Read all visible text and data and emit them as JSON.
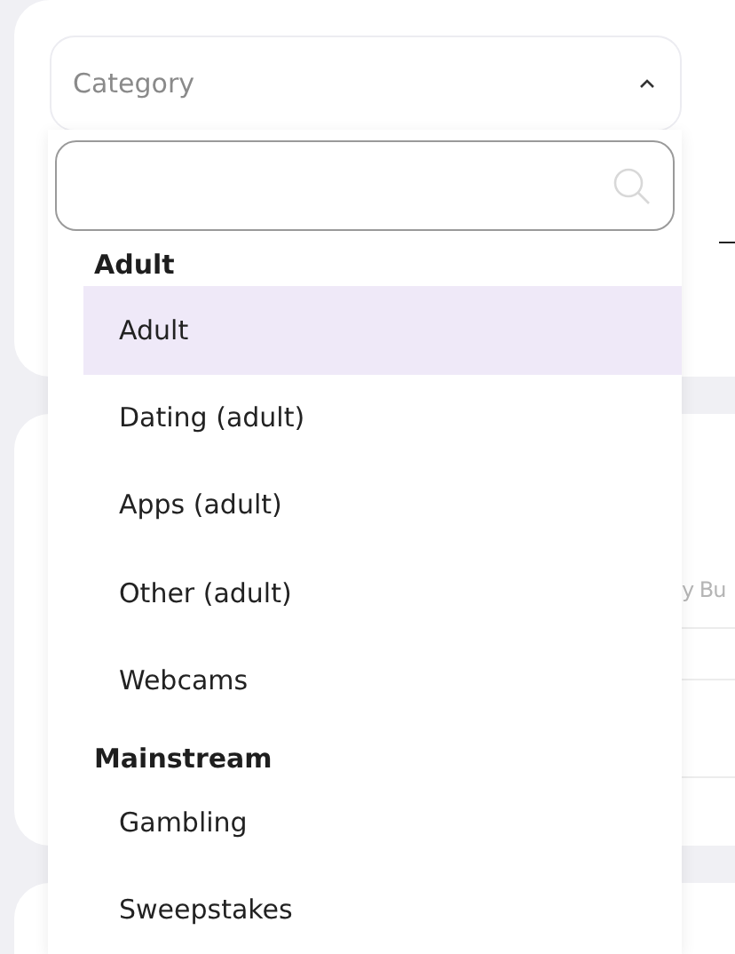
{
  "category_select": {
    "placeholder": "Category",
    "expanded": true
  },
  "dropdown": {
    "groups": [
      {
        "heading": "Adult",
        "options": [
          {
            "label": "Adult",
            "selected": true
          },
          {
            "label": "Dating (adult)",
            "selected": false
          },
          {
            "label": "Apps (adult)",
            "selected": false
          },
          {
            "label": "Other (adult)",
            "selected": false
          },
          {
            "label": "Webcams",
            "selected": false
          }
        ]
      },
      {
        "heading": "Mainstream",
        "options": [
          {
            "label": "Gambling",
            "selected": false
          },
          {
            "label": "Sweepstakes",
            "selected": false
          }
        ]
      }
    ]
  },
  "background_card": {
    "cut_text": "y Bu"
  }
}
